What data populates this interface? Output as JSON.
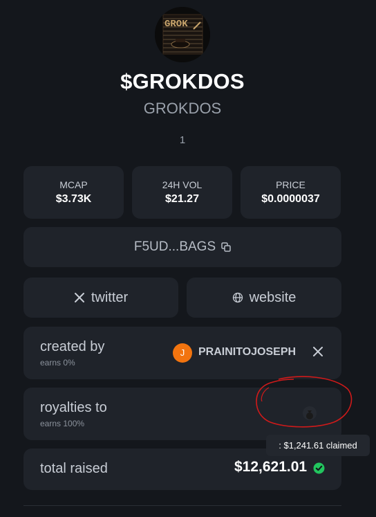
{
  "token": {
    "logo_text": "GROK",
    "ticker": "$GROKDOS",
    "name": "GROKDOS",
    "count": "1"
  },
  "stats": [
    {
      "label": "MCAP",
      "value": "$3.73K"
    },
    {
      "label": "24H VOL",
      "value": "$21.27"
    },
    {
      "label": "PRICE",
      "value": "$0.0000037"
    }
  ],
  "address": {
    "text": "F5UD...BAGS",
    "icon": "copy-icon"
  },
  "links": {
    "twitter": {
      "label": "twitter",
      "icon": "x-icon"
    },
    "website": {
      "label": "website",
      "icon": "globe-icon"
    }
  },
  "creator": {
    "title": "created by",
    "earns": "earns 0%",
    "avatar_letter": "J",
    "avatar_color": "#f2740f",
    "username": "PRAINITOJOSEPH",
    "icon": "x-icon"
  },
  "royalties": {
    "title": "royalties to",
    "earns": "earns 100%",
    "icon": "money-bag-icon"
  },
  "raised": {
    "title": "total raised",
    "value": "$12,621.01",
    "icon": "verified-check-icon",
    "check_color": "#22c55e"
  },
  "tooltip": {
    "text": ": $1,241.61 claimed"
  },
  "colors": {
    "background": "#14171c",
    "card": "#1f232a",
    "annotation": "#d11a1a"
  }
}
